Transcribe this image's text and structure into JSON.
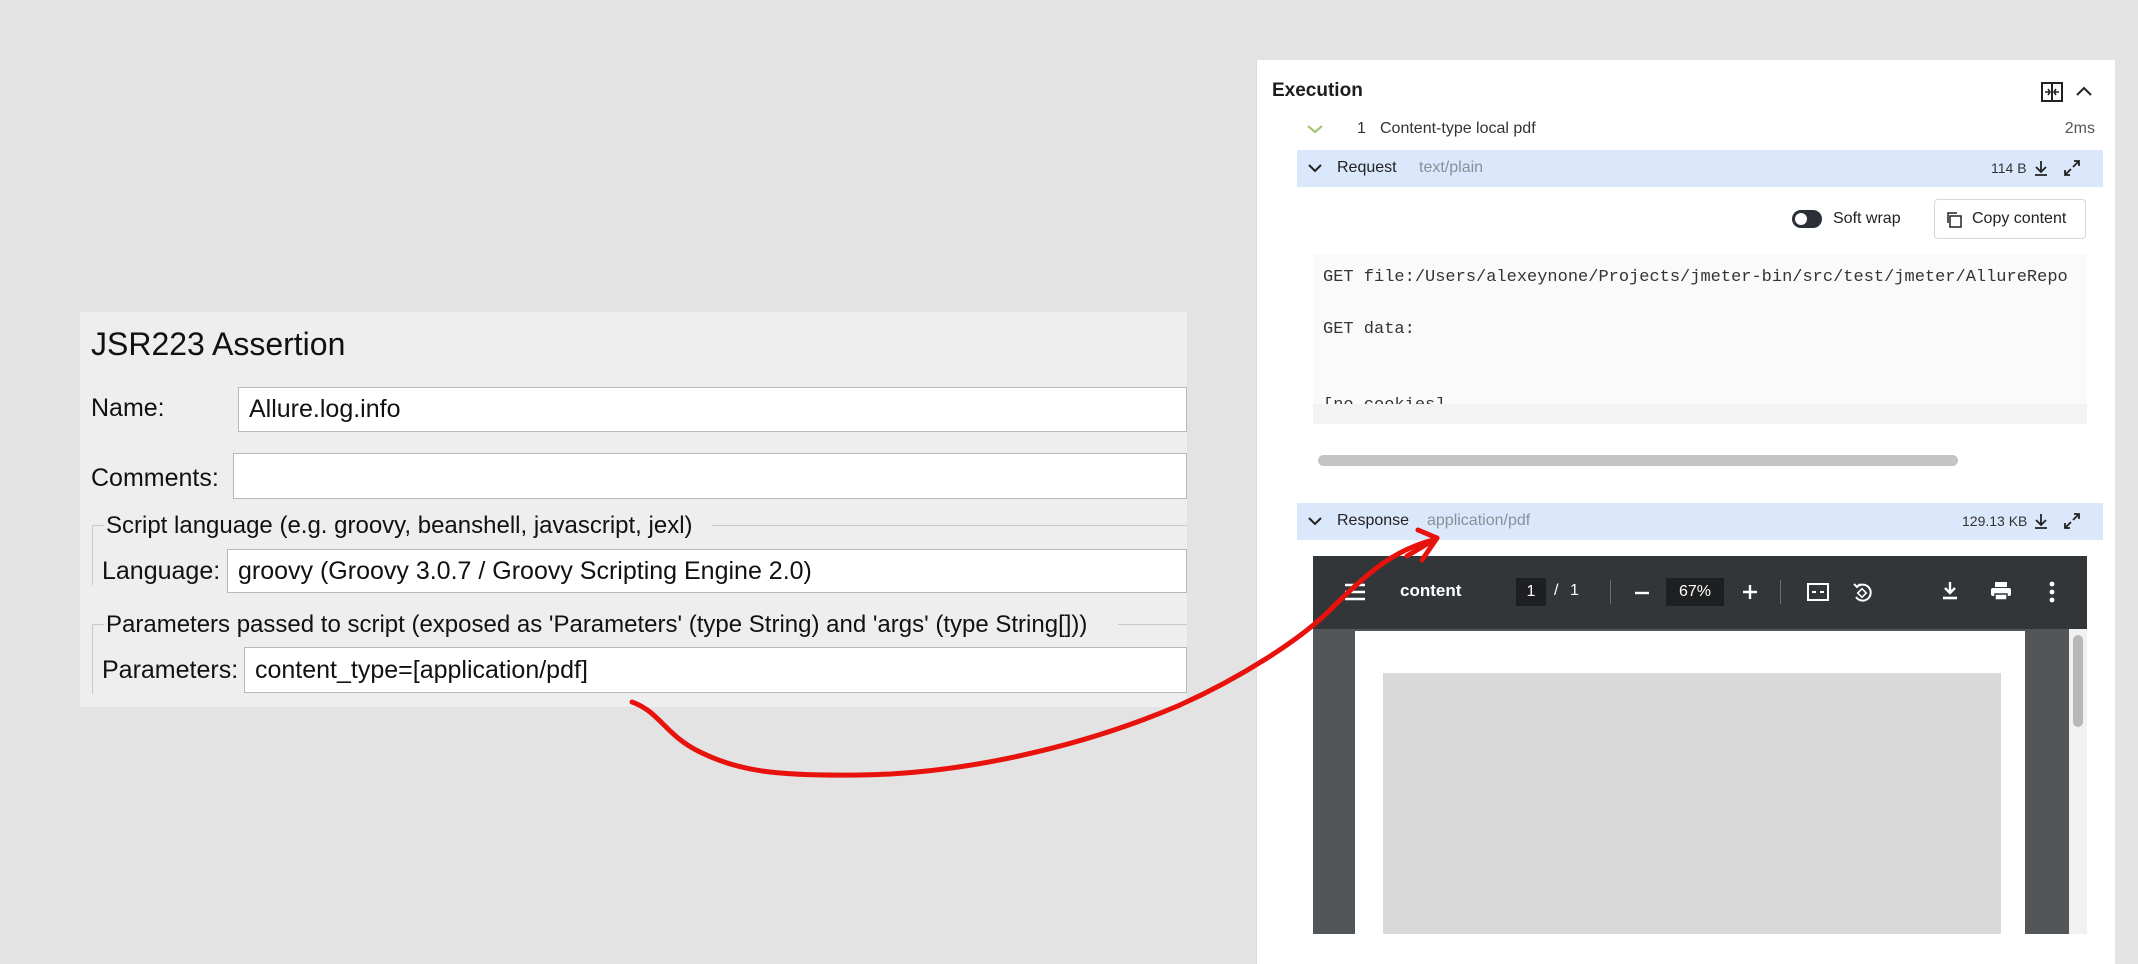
{
  "jmeter": {
    "title": "JSR223 Assertion",
    "name_label": "Name:",
    "name_value": "Allure.log.info",
    "comments_label": "Comments:",
    "comments_value": "",
    "script_group_label": "Script language (e.g. groovy, beanshell, javascript, jexl)",
    "language_label": "Language:",
    "language_value": "groovy     (Groovy 3.0.7 / Groovy Scripting Engine 2.0)",
    "params_group_label": "Parameters passed to script (exposed as 'Parameters' (type String) and 'args' (type String[]))",
    "params_label": "Parameters:",
    "params_value": "content_type=[application/pdf]"
  },
  "execution": {
    "title": "Execution",
    "step": {
      "index": "1",
      "name": "Content-type local pdf",
      "duration": "2ms"
    },
    "request": {
      "label": "Request",
      "mime": "text/plain",
      "size": "114 B",
      "soft_wrap_label": "Soft wrap",
      "copy_label": "Copy content",
      "lines": [
        "GET file:/Users/alexeynone/Projects/jmeter-bin/src/test/jmeter/AllureRepo",
        "GET data:",
        "[no cookies]"
      ]
    },
    "response": {
      "label": "Response",
      "mime": "application/pdf",
      "size": "129.13 KB"
    },
    "pdf_viewer": {
      "title": "content",
      "page_current": "1",
      "page_sep": "/",
      "page_total": "1",
      "zoom": "67%"
    }
  },
  "colors": {
    "accent_bar": "#dbe8fb",
    "arrow": "#e8120c",
    "pdf_toolbar": "#323639"
  },
  "icons": [
    "split-view-icon",
    "chevron-up-icon",
    "chevron-down-icon",
    "download-icon",
    "expand-icon",
    "toggle-icon",
    "copy-icon",
    "menu-icon",
    "minus-icon",
    "plus-icon",
    "fit-page-icon",
    "rotate-icon",
    "print-icon",
    "more-icon"
  ]
}
